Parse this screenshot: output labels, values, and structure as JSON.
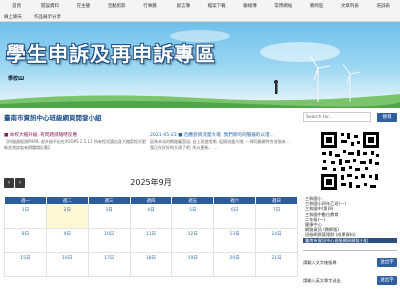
{
  "nav": {
    "row1": [
      "首頁",
      "開設資料",
      "在主播",
      "活動剪影",
      "行事曆",
      "留言簿",
      "檔案下載",
      "聯絡簿",
      "常用網站",
      "教師區",
      "文章列表",
      "培訓表"
    ],
    "row2": [
      "線上聊天",
      "作品展示分享"
    ]
  },
  "banner": {
    "title": "學生申訴及再申訴專區",
    "subtitle": "學校Ш"
  },
  "section": {
    "title": "臺南市資訊中心班級網頁開發小組"
  },
  "news": [
    {
      "title": "■ 本校大檔升級, 有問題請隨時反應",
      "desc": "【伺服器經過PHP8, 若升級不出在XOOPS 2.5.11 所有程式請自身大檔案程式更新並測試若有問題請反應】",
      "color": "maroon"
    },
    {
      "title": "2021-05-23 ■ 因應疫情流量大增, 我們新的伺服器的以證...",
      "desc": "因為本站的網路圖案因, 自上班使用期, 疫情流量大增, 一律同路做特合並換為 ... 我正在好好的大改了吧, 所以更新。 ...",
      "color": "blue"
    }
  ],
  "calendar": {
    "prev_label": "‹",
    "next_label": "›",
    "title": "2025年9月",
    "weekdays": [
      "週一",
      "週二",
      "週三",
      "週四",
      "週五",
      "週六",
      "週日"
    ],
    "rows": [
      [
        "1日",
        "2日",
        "3日",
        "4日",
        "5日",
        "6日",
        "7日"
      ],
      [
        "8日",
        "9日",
        "10日",
        "11日",
        "12日",
        "13日",
        "14日"
      ],
      [
        "15日",
        "16日",
        "17日",
        "18日",
        "19日",
        "20日",
        "21日"
      ]
    ]
  },
  "sidebar": {
    "search_placeholder": "Search for...",
    "search_button": "搜尋",
    "links": [
      "三和國小",
      "三和國小四年乙班(一)",
      "三和國中(第四)",
      "三和國中數位教育",
      "二年級(一)",
      "健康中心",
      "網路資訊 (教師版)",
      "班級網頁管理群 (成果資料)",
      "臺南市資訊中心班級網頁開發小組"
    ],
    "lang1_label": "請輸入文字後搜尋",
    "lang1_button": "送出字",
    "lang2_label": "請輸入英文單字送出",
    "lang2_button": "送出字"
  },
  "colors": {
    "nav_bg": "#f4f4f4",
    "accent": "#2b5c9e",
    "today_bg": "#fdf7d2"
  }
}
